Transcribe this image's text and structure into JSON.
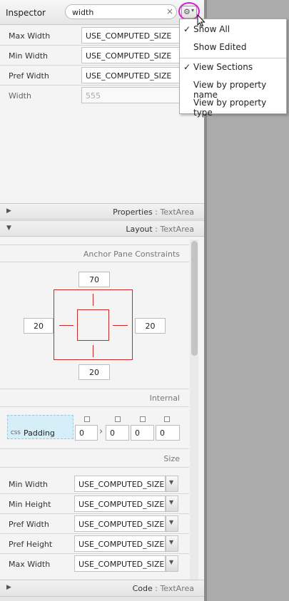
{
  "header": {
    "title": "Inspector",
    "search_value": "width",
    "clear_icon": "×",
    "gear_icon": "⚙",
    "caret_icon": "▾"
  },
  "fields": [
    {
      "label": "Max Width",
      "value": "USE_COMPUTED_SIZE"
    },
    {
      "label": "Min Width",
      "value": "USE_COMPUTED_SIZE"
    },
    {
      "label": "Pref Width",
      "value": "USE_COMPUTED_SIZE"
    },
    {
      "label": "Width",
      "value": "555"
    }
  ],
  "menu": {
    "items": [
      {
        "check": "✓",
        "label": "Show All"
      },
      {
        "check": "",
        "label": "Show Edited"
      },
      {
        "check": "✓",
        "label": "View Sections"
      },
      {
        "check": "",
        "label": "View by property name"
      },
      {
        "check": "",
        "label": "View by property type"
      }
    ]
  },
  "sections": {
    "properties": {
      "title": "Properties",
      "sep": " : ",
      "type": "TextArea",
      "collapsed_icon": "▶"
    },
    "layout": {
      "title": "Layout",
      "sep": " : ",
      "type": "TextArea",
      "expanded_icon": "▼"
    },
    "code": {
      "title": "Code",
      "sep": " : ",
      "type": "TextArea",
      "collapsed_icon": "▶"
    }
  },
  "layout": {
    "anchor_title": "Anchor Pane Constraints",
    "anchor": {
      "top": "70",
      "left": "20",
      "right": "20",
      "bottom": "20"
    },
    "internal_title": "Internal",
    "padding": {
      "css_tag": "CSS",
      "label": "Padding",
      "values": [
        "0",
        "0",
        "0",
        "0"
      ],
      "link_glyph": "›"
    },
    "size_title": "Size",
    "size_fields": [
      {
        "label": "Min Width",
        "value": "USE_COMPUTED_SIZE"
      },
      {
        "label": "Min Height",
        "value": "USE_COMPUTED_SIZE"
      },
      {
        "label": "Pref Width",
        "value": "USE_COMPUTED_SIZE"
      },
      {
        "label": "Pref Height",
        "value": "USE_COMPUTED_SIZE"
      },
      {
        "label": "Max Width",
        "value": "USE_COMPUTED_SIZE"
      }
    ],
    "dropdown_icon": "▼"
  }
}
